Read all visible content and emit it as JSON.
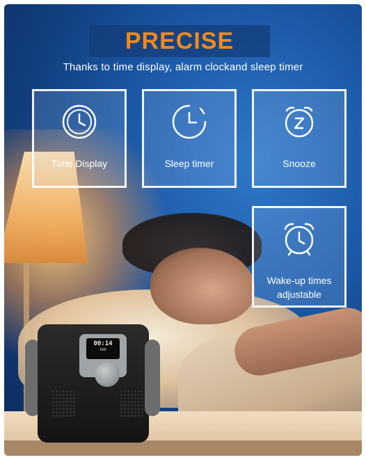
{
  "headline": {
    "title": "PRECISE",
    "subtitle": "Thanks to time display, alarm clockand sleep timer"
  },
  "features": [
    {
      "label": "Time Display",
      "icon": "clock-icon"
    },
    {
      "label": "Sleep timer",
      "icon": "sleep-timer-icon"
    },
    {
      "label": "Snooze",
      "icon": "snooze-icon"
    },
    {
      "label_line1": "Wake-up times",
      "label_line2": "adjustable",
      "icon": "alarm-clock-icon"
    }
  ],
  "radio_display": {
    "time": "00:14",
    "line2": "DAB"
  },
  "colors": {
    "title_orange": "#f08a1c",
    "background_blue": "#1c5aa8",
    "box_border": "#ffffff"
  }
}
